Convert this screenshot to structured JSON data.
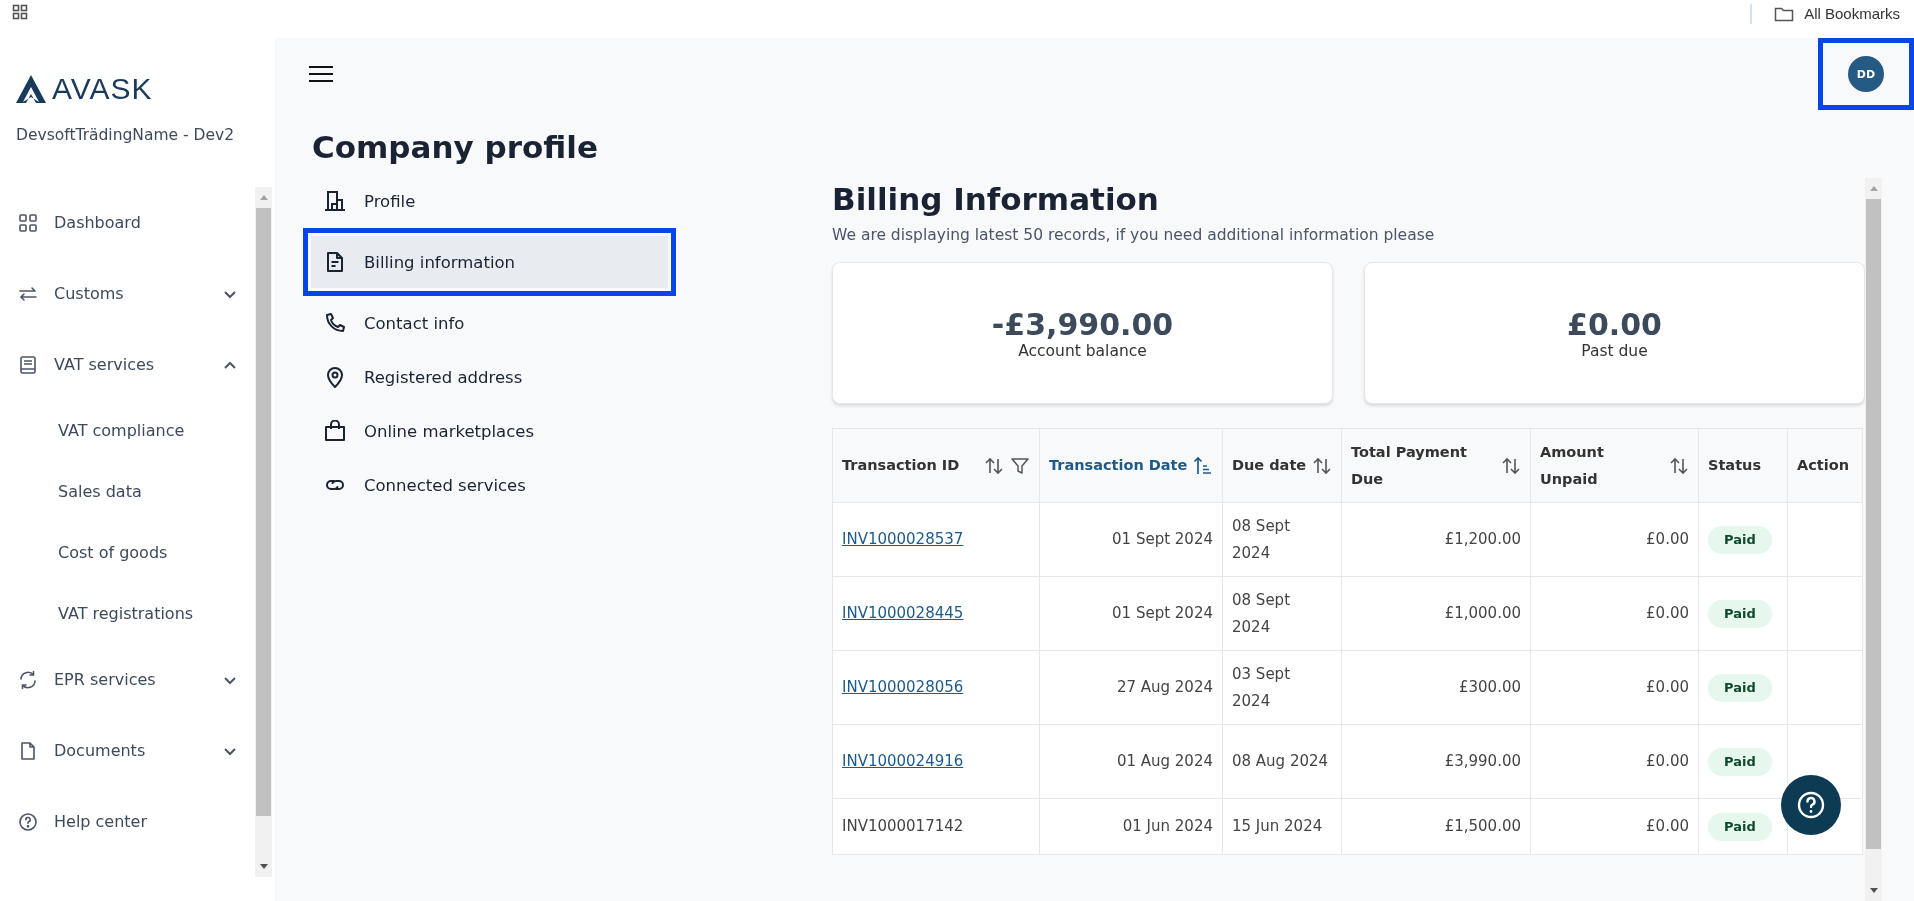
{
  "browser": {
    "bookmarks": "All Bookmarks"
  },
  "brand": {
    "logo": "AVASK",
    "company": "DevsoftTrädingName - Dev2"
  },
  "sidebar": {
    "items": [
      {
        "label": "Dashboard",
        "kind": "link"
      },
      {
        "label": "Customs",
        "kind": "group",
        "expanded": false
      },
      {
        "label": "VAT services",
        "kind": "group",
        "expanded": true,
        "children": [
          {
            "label": "VAT compliance"
          },
          {
            "label": "Sales data"
          },
          {
            "label": "Cost of goods"
          },
          {
            "label": "VAT registrations"
          }
        ]
      },
      {
        "label": "EPR services",
        "kind": "group",
        "expanded": false
      },
      {
        "label": "Documents",
        "kind": "group",
        "expanded": false
      },
      {
        "label": "Help center",
        "kind": "link"
      }
    ]
  },
  "header": {
    "avatar": {
      "initials": "DD",
      "highlighted": true
    }
  },
  "profile": {
    "title": "Company profile",
    "items": [
      {
        "label": "Profile",
        "selected": false,
        "highlighted": false
      },
      {
        "label": "Billing information",
        "selected": true,
        "highlighted": true
      },
      {
        "label": "Contact info",
        "selected": false,
        "highlighted": false
      },
      {
        "label": "Registered address",
        "selected": false,
        "highlighted": false
      },
      {
        "label": "Online marketplaces",
        "selected": false,
        "highlighted": false
      },
      {
        "label": "Connected services",
        "selected": false,
        "highlighted": false
      }
    ]
  },
  "billing": {
    "title": "Billing Information",
    "subtitle": "We are displaying latest 50 records, if you need additional information please",
    "cards": [
      {
        "amount": "-£3,990.00",
        "label": "Account balance"
      },
      {
        "amount": "£0.00",
        "label": "Past due"
      }
    ],
    "table": {
      "columns": [
        {
          "label": "Transaction ID",
          "sortable": true,
          "filter": true,
          "selected": false
        },
        {
          "label": "Transaction Date",
          "sortable": true,
          "filter": false,
          "selected": true
        },
        {
          "label": "Due date",
          "sortable": true,
          "filter": false,
          "selected": false
        },
        {
          "label": "Total Payment Due",
          "sortable": true,
          "filter": false,
          "selected": false
        },
        {
          "label": "Amount Unpaid",
          "sortable": true,
          "filter": false,
          "selected": false
        },
        {
          "label": "Status",
          "sortable": false,
          "filter": false,
          "selected": false
        },
        {
          "label": "Action",
          "sortable": false,
          "filter": false,
          "selected": false
        }
      ],
      "rows": [
        {
          "id": "INV1000028537",
          "link": true,
          "date": "01 Sept 2024",
          "due": "08 Sept 2024",
          "total": "£1,200.00",
          "unpaid": "£0.00",
          "status": "Paid"
        },
        {
          "id": "INV1000028445",
          "link": true,
          "date": "01 Sept 2024",
          "due": "08 Sept 2024",
          "total": "£1,000.00",
          "unpaid": "£0.00",
          "status": "Paid"
        },
        {
          "id": "INV1000028056",
          "link": true,
          "date": "27 Aug 2024",
          "due": "03 Sept 2024",
          "total": "£300.00",
          "unpaid": "£0.00",
          "status": "Paid"
        },
        {
          "id": "INV1000024916",
          "link": true,
          "date": "01 Aug 2024",
          "due": "08 Aug 2024",
          "total": "£3,990.00",
          "unpaid": "£0.00",
          "status": "Paid"
        },
        {
          "id": "INV1000017142",
          "link": false,
          "date": "01 Jun 2024",
          "due": "15 Jun 2024",
          "total": "£1,500.00",
          "unpaid": "£0.00",
          "status": "Paid"
        }
      ]
    }
  }
}
